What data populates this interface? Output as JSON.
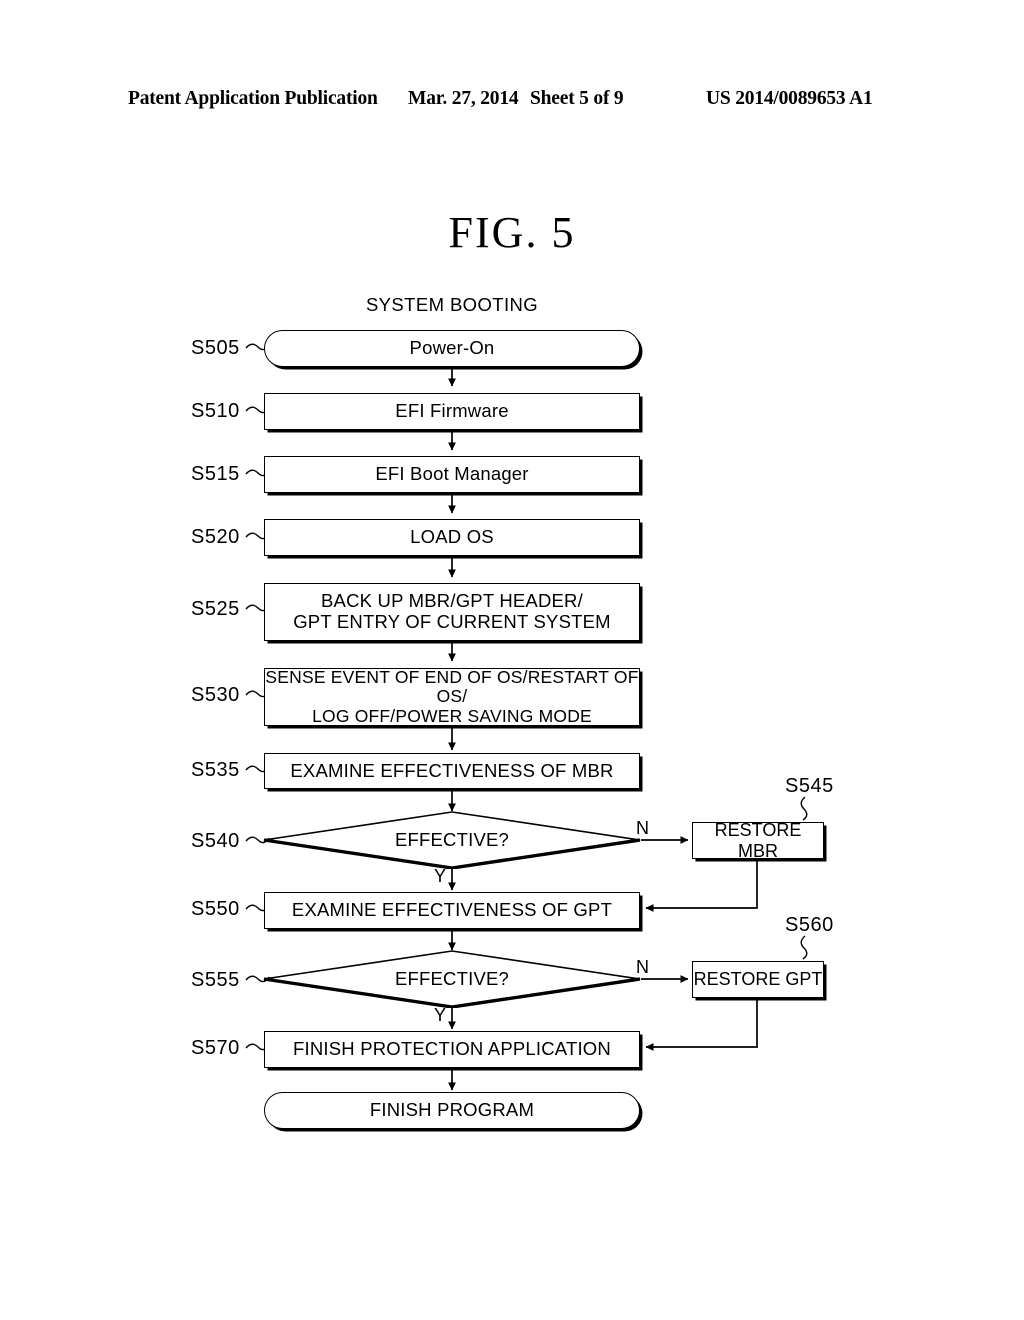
{
  "header": {
    "left": "Patent Application Publication",
    "date": "Mar. 27, 2014",
    "sheet": "Sheet 5 of 9",
    "number": "US 2014/0089653 A1"
  },
  "figure": {
    "title": "FIG.  5",
    "caption": "SYSTEM BOOTING"
  },
  "flowchart": {
    "type": "flowchart",
    "nodes": [
      {
        "id": "S505",
        "step": "S505",
        "label": "Power-On",
        "shape": "terminal"
      },
      {
        "id": "S510",
        "step": "S510",
        "label": "EFI Firmware",
        "shape": "process"
      },
      {
        "id": "S515",
        "step": "S515",
        "label": "EFI Boot Manager",
        "shape": "process"
      },
      {
        "id": "S520",
        "step": "S520",
        "label": "LOAD OS",
        "shape": "process"
      },
      {
        "id": "S525",
        "step": "S525",
        "label_line1": "BACK UP MBR/GPT HEADER/",
        "label_line2": "GPT ENTRY OF CURRENT SYSTEM",
        "shape": "process"
      },
      {
        "id": "S530",
        "step": "S530",
        "label_line1": "SENSE EVENT OF END OF OS/RESTART OF OS/",
        "label_line2": "LOG OFF/POWER SAVING MODE",
        "shape": "process"
      },
      {
        "id": "S535",
        "step": "S535",
        "label": "EXAMINE EFFECTIVENESS OF MBR",
        "shape": "process"
      },
      {
        "id": "S540",
        "step": "S540",
        "label": "EFFECTIVE?",
        "shape": "decision"
      },
      {
        "id": "S545",
        "step": "S545",
        "label": "RESTORE MBR",
        "shape": "process"
      },
      {
        "id": "S550",
        "step": "S550",
        "label": "EXAMINE EFFECTIVENESS OF GPT",
        "shape": "process"
      },
      {
        "id": "S555",
        "step": "S555",
        "label": "EFFECTIVE?",
        "shape": "decision"
      },
      {
        "id": "S560",
        "step": "S560",
        "label": "RESTORE GPT",
        "shape": "process"
      },
      {
        "id": "S570",
        "step": "S570",
        "label": "FINISH PROTECTION APPLICATION",
        "shape": "process"
      },
      {
        "id": "END",
        "step": "",
        "label": "FINISH PROGRAM",
        "shape": "terminal"
      }
    ],
    "branch_labels": {
      "mbr_no": "N",
      "mbr_yes": "Y",
      "gpt_no": "N",
      "gpt_yes": "Y"
    }
  },
  "colors": {
    "ink": "#000000",
    "paper": "#ffffff"
  }
}
